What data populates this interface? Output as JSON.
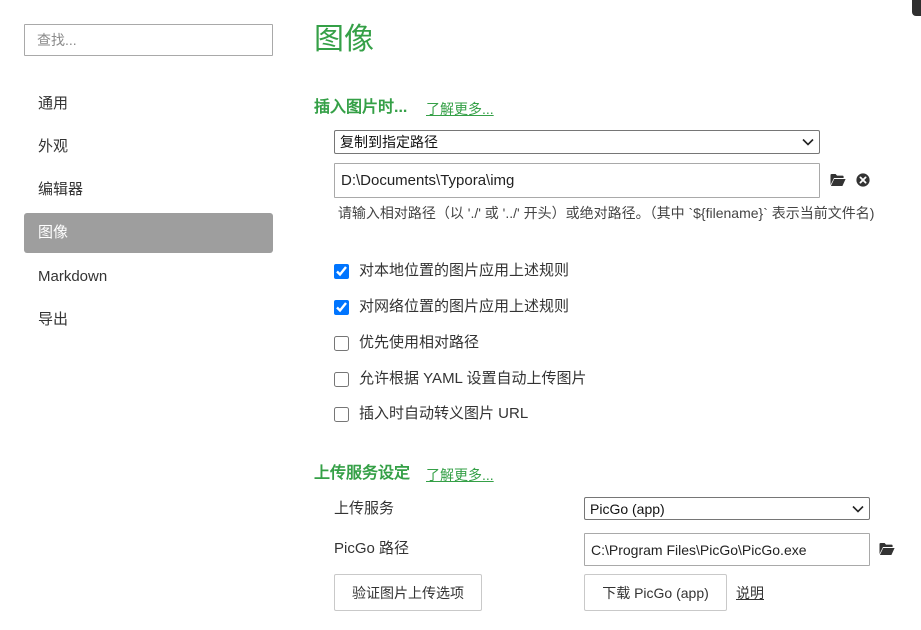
{
  "sidebar": {
    "search": {
      "placeholder": "查找..."
    },
    "items": [
      {
        "label": "通用",
        "selected": false
      },
      {
        "label": "外观",
        "selected": false
      },
      {
        "label": "编辑器",
        "selected": false
      },
      {
        "label": "图像",
        "selected": true
      },
      {
        "label": "Markdown",
        "selected": false
      },
      {
        "label": "导出",
        "selected": false
      }
    ]
  },
  "main": {
    "title": "图像",
    "insert_section": {
      "heading": "插入图片时...",
      "learn_more": "了解更多...",
      "action_select": {
        "value": "复制到指定路径"
      },
      "path_input": {
        "value": "D:\\Documents\\Typora\\img"
      },
      "icons": {
        "browse": "folder-open-icon",
        "clear": "close-circle-icon"
      },
      "hint": "请输入相对路径（以 './' 或 '../' 开头）或绝对路径。（其中 `${filename}` 表示当前文件名)",
      "options": [
        {
          "label": "对本地位置的图片应用上述规则",
          "checked": true
        },
        {
          "label": "对网络位置的图片应用上述规则",
          "checked": true
        },
        {
          "label": "优先使用相对路径",
          "checked": false
        },
        {
          "label": "允许根据 YAML 设置自动上传图片",
          "checked": false
        },
        {
          "label": "插入时自动转义图片 URL",
          "checked": false
        }
      ]
    },
    "upload_section": {
      "heading": "上传服务设定",
      "learn_more": "了解更多...",
      "service_label": "上传服务",
      "service_select": {
        "value": "PicGo (app)"
      },
      "path_label": "PicGo 路径",
      "path_input": {
        "value": "C:\\Program Files\\PicGo\\PicGo.exe"
      },
      "icons": {
        "browse": "folder-open-icon"
      },
      "verify_button": "验证图片上传选项",
      "download_button": "下载 PicGo (app)",
      "help_link": "说明"
    }
  },
  "colors": {
    "accent": "#35a047",
    "selected_bg": "#9e9e9e",
    "text": "#333333",
    "checkbox": "#0075ff"
  }
}
